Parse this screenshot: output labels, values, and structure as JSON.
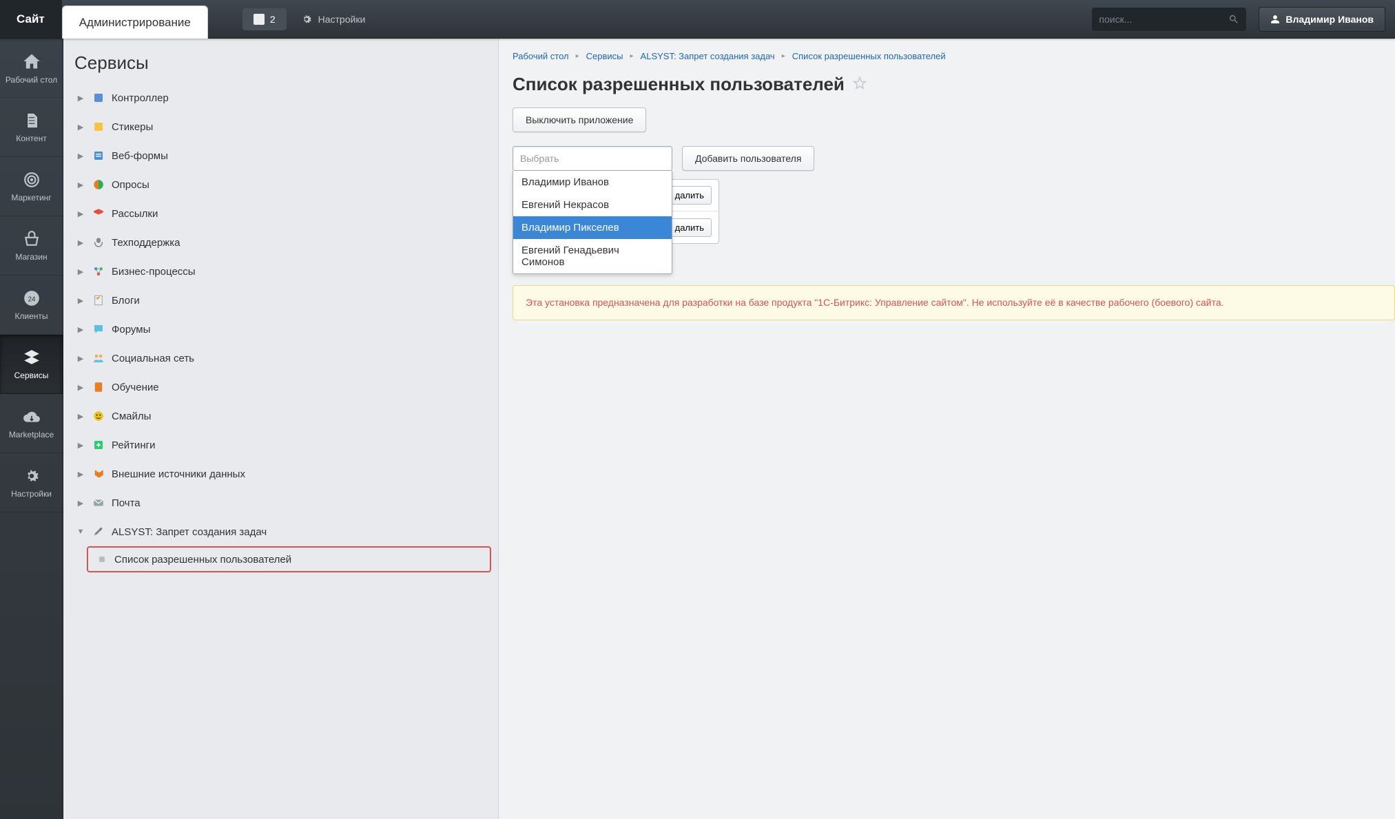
{
  "topbar": {
    "site_tab": "Сайт",
    "admin_tab": "Администрирование",
    "notif_count": "2",
    "settings_label": "Настройки",
    "search_placeholder": "поиск...",
    "user_name": "Владимир Иванов"
  },
  "leftrail": {
    "items": [
      {
        "label": "Рабочий стол"
      },
      {
        "label": "Контент"
      },
      {
        "label": "Маркетинг"
      },
      {
        "label": "Магазин"
      },
      {
        "label": "Клиенты"
      },
      {
        "label": "Сервисы"
      },
      {
        "label": "Marketplace"
      },
      {
        "label": "Настройки"
      }
    ]
  },
  "midpanel": {
    "title": "Сервисы",
    "tree": [
      {
        "label": "Контроллер"
      },
      {
        "label": "Стикеры"
      },
      {
        "label": "Веб-формы"
      },
      {
        "label": "Опросы"
      },
      {
        "label": "Рассылки"
      },
      {
        "label": "Техподдержка"
      },
      {
        "label": "Бизнес-процессы"
      },
      {
        "label": "Блоги"
      },
      {
        "label": "Форумы"
      },
      {
        "label": "Социальная сеть"
      },
      {
        "label": "Обучение"
      },
      {
        "label": "Смайлы"
      },
      {
        "label": "Рейтинги"
      },
      {
        "label": "Внешние источники данных"
      },
      {
        "label": "Почта"
      },
      {
        "label": "ALSYST: Запрет создания задач"
      }
    ],
    "subitem_label": "Список разрешенных пользователей"
  },
  "breadcrumb": {
    "items": [
      "Рабочий стол",
      "Сервисы",
      "ALSYST: Запрет создания задач",
      "Список разрешенных пользователей"
    ]
  },
  "content": {
    "title": "Список разрешенных пользователей",
    "disable_btn": "Выключить приложение",
    "select_placeholder": "Выбрать",
    "add_btn": "Добавить пользователя",
    "dropdown": [
      "Владимир Иванов",
      "Евгений Некрасов",
      "Владимир Пикселев",
      "Евгений Генадьевич Симонов"
    ],
    "dropdown_active_index": 2,
    "user_rows": [
      {
        "delete_label": "далить"
      },
      {
        "delete_label": "далить"
      }
    ],
    "warning": "Эта установка предназначена для разработки на базе продукта \"1С-Битрикс: Управление сайтом\". Не используйте её в качестве рабочего (боевого) сайта."
  }
}
